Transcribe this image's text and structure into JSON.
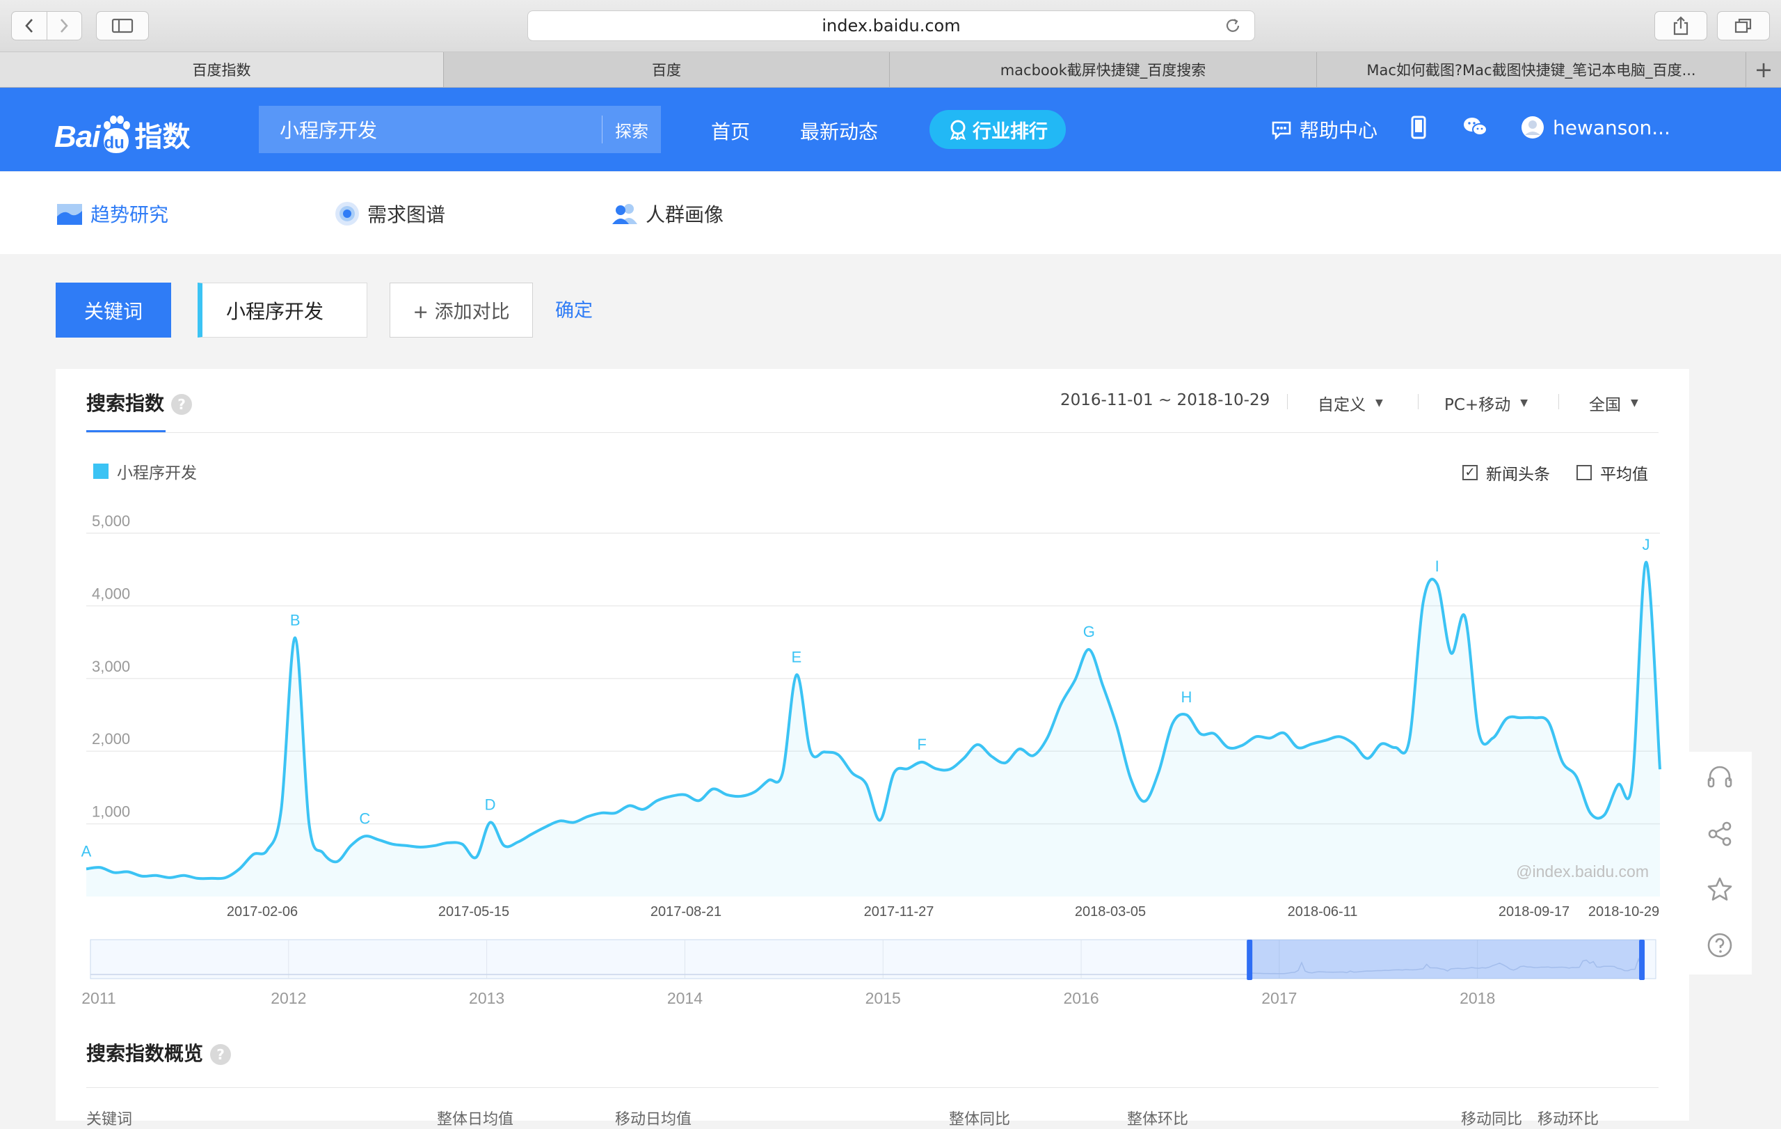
{
  "browser": {
    "url": "index.baidu.com",
    "tabs": [
      "百度指数",
      "百度",
      "macbook截屏快捷键_百度搜索",
      "Mac如何截图?Mac截图快捷键_笔记本电脑_百度..."
    ],
    "new_tab": "+"
  },
  "header": {
    "logo_text": "Bai",
    "logo_du": "du",
    "logo_suffix": "指数",
    "search_value": "小程序开发",
    "search_button": "探索",
    "nav": [
      "首页",
      "最新动态"
    ],
    "rank_button": "行业排行",
    "help": "帮助中心",
    "username": "hewanson..."
  },
  "subnav": [
    "趋势研究",
    "需求图谱",
    "人群画像"
  ],
  "keyword_row": {
    "label": "关键词",
    "keyword": "小程序开发",
    "add_compare": "+ 添加对比",
    "confirm": "确定"
  },
  "search_index": {
    "title": "搜索指数",
    "help_glyph": "?",
    "date_range": "2016-11-01 ~ 2018-10-29",
    "period": "自定义",
    "device": "PC+移动",
    "region": "全国",
    "legend": "小程序开发",
    "checkbox_news": "新闻头条",
    "checkbox_news_checked": true,
    "checkbox_avg": "平均值",
    "checkbox_avg_checked": false,
    "watermark": "@index.baidu.com",
    "series_color": "#3bc3f4"
  },
  "chart_data": {
    "type": "area",
    "ylim": [
      0,
      5000
    ],
    "yticks": [
      "5,000",
      "4,000",
      "3,000",
      "2,000",
      "1,000"
    ],
    "xticks": [
      "2017-02-06",
      "2017-05-15",
      "2017-08-21",
      "2017-11-27",
      "2018-03-05",
      "2018-06-11",
      "2018-09-17",
      "2018-10-29"
    ],
    "series": [
      {
        "name": "小程序开发",
        "values": [
          380,
          400,
          330,
          340,
          280,
          290,
          260,
          290,
          250,
          250,
          260,
          380,
          580,
          640,
          1200,
          3560,
          1000,
          600,
          480,
          700,
          830,
          780,
          720,
          700,
          680,
          700,
          740,
          720,
          540,
          1020,
          700,
          750,
          860,
          960,
          1040,
          1020,
          1100,
          1150,
          1150,
          1250,
          1200,
          1320,
          1380,
          1400,
          1320,
          1480,
          1400,
          1380,
          1440,
          1600,
          1700,
          3050,
          2000,
          1990,
          1950,
          1700,
          1550,
          1050,
          1700,
          1760,
          1850,
          1760,
          1750,
          1900,
          2090,
          1930,
          1840,
          2030,
          1940,
          2180,
          2650,
          2980,
          3400,
          2900,
          2340,
          1620,
          1310,
          1710,
          2380,
          2500,
          2240,
          2240,
          2050,
          2080,
          2200,
          2180,
          2250,
          2050,
          2100,
          2150,
          2200,
          2100,
          1900,
          2100,
          2050,
          2150,
          4050,
          4300,
          3350,
          3850,
          2250,
          2180,
          2450,
          2460,
          2460,
          2400,
          1850,
          1650,
          1150,
          1120,
          1540,
          1560,
          4600,
          1750
        ],
        "point_labels": [
          {
            "label": "A",
            "index": 0
          },
          {
            "label": "B",
            "index": 15
          },
          {
            "label": "C",
            "index": 20
          },
          {
            "label": "D",
            "index": 29
          },
          {
            "label": "E",
            "index": 51
          },
          {
            "label": "F",
            "index": 60
          },
          {
            "label": "G",
            "index": 72
          },
          {
            "label": "H",
            "index": 79
          },
          {
            "label": "I",
            "index": 97
          },
          {
            "label": "J",
            "index": 112
          }
        ]
      }
    ],
    "brush_years": [
      "2011",
      "2012",
      "2013",
      "2014",
      "2015",
      "2016",
      "2017",
      "2018"
    ],
    "brush_selection_years": [
      2016.85,
      2018.83
    ]
  },
  "overview": {
    "title": "搜索指数概览",
    "headers": [
      "关键词",
      "整体日均值",
      "移动日均值",
      "整体同比",
      "整体环比",
      "移动同比",
      "移动环比"
    ]
  }
}
